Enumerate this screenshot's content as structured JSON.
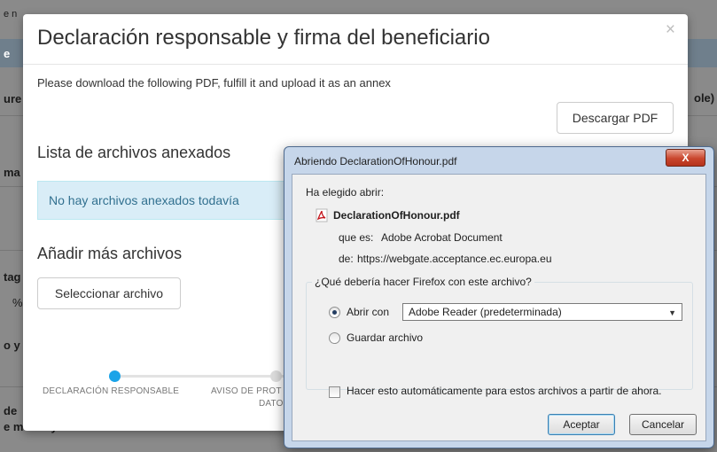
{
  "background": {
    "fragments": [
      "e n",
      "e",
      "ure",
      "ma",
      "tag",
      "%",
      "o y",
      "de",
      "e mobility ?",
      "ole)"
    ]
  },
  "modal": {
    "title": "Declaración responsable y firma del beneficiario",
    "close_label": "×",
    "instruction": "Please download the following PDF, fulfill it and upload it as an annex",
    "download_button": "Descargar PDF",
    "annex_list_heading": "Lista de archivos anexados",
    "no_annexes_message": "No hay archivos anexados todavía",
    "add_files_heading": "Añadir más archivos",
    "select_file_button": "Seleccionar archivo",
    "steps": [
      {
        "label": "DECLARACIÓN RESPONSABLE",
        "active": true
      },
      {
        "label": "AVISO DE PROT",
        "label_line2": "DATO",
        "active": false
      }
    ]
  },
  "dialog": {
    "title": "Abriendo DeclarationOfHonour.pdf",
    "close_icon": "X",
    "chosen_label": "Ha elegido abrir:",
    "file_name": "DeclarationOfHonour.pdf",
    "type_prefix": "que es:",
    "type_value": "Adobe Acrobat Document",
    "from_prefix": "de:",
    "from_value": "https://webgate.acceptance.ec.europa.eu",
    "question": "¿Qué debería hacer Firefox con este archivo?",
    "open_with_label": "Abrir con",
    "open_with_app": "Adobe Reader  (predeterminada)",
    "save_label": "Guardar archivo",
    "auto_label": "Hacer esto automáticamente para estos archivos a partir de ahora.",
    "ok_button": "Aceptar",
    "cancel_button": "Cancelar",
    "open_with_selected": true,
    "auto_checked": false
  },
  "colors": {
    "step_active": "#1aa3e8",
    "alert_bg": "#d9edf7",
    "alert_text": "#31708f",
    "dialog_frame": "#c6d6ea"
  }
}
